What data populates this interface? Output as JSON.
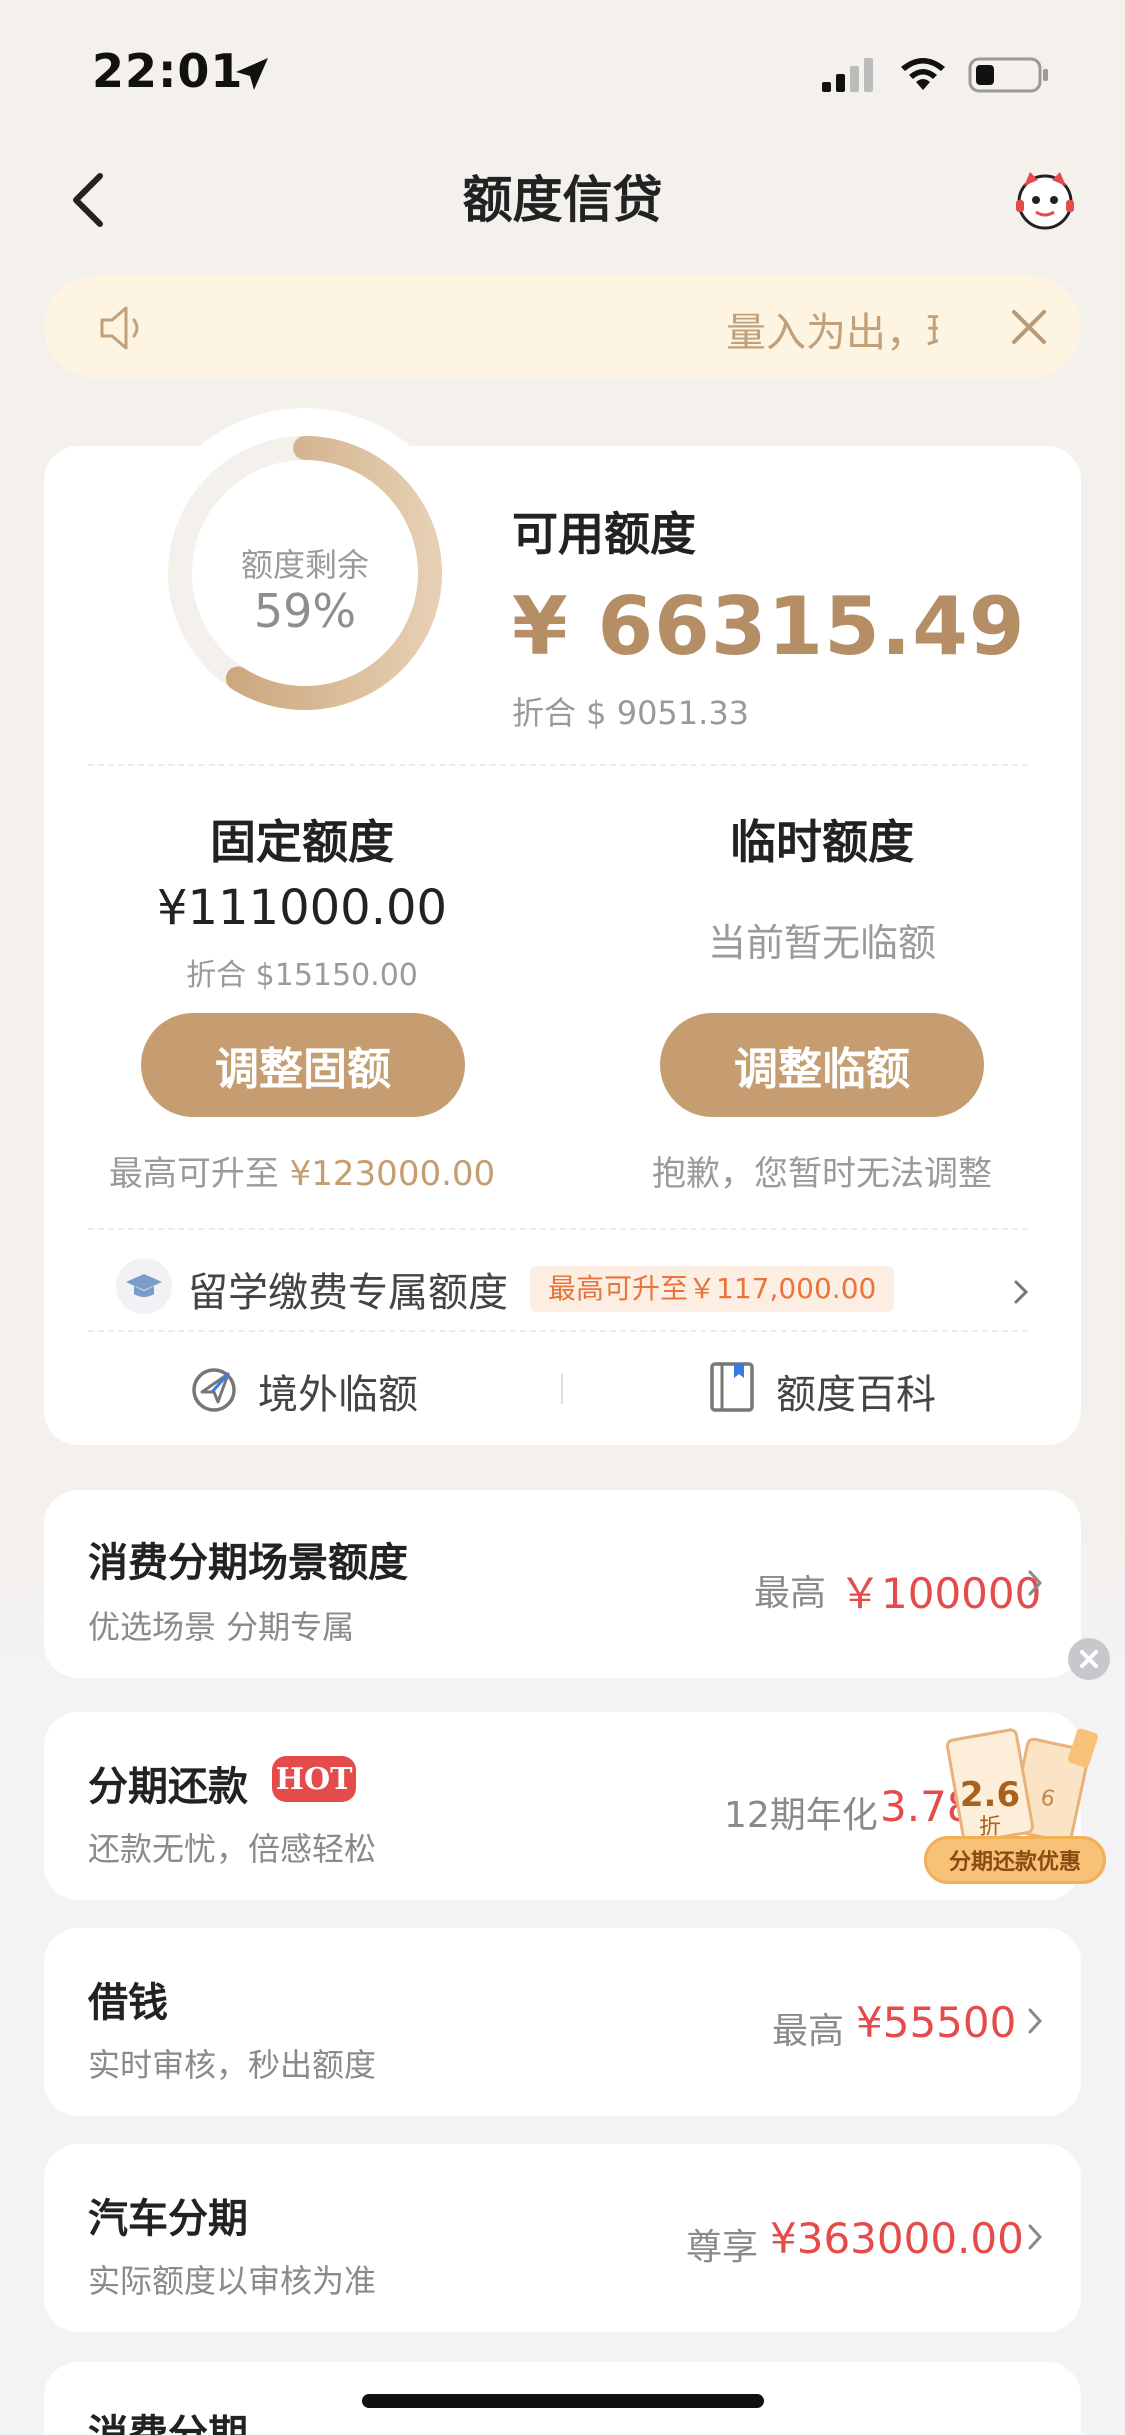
{
  "status_bar": {
    "time": "22:01"
  },
  "nav": {
    "title": "额度信贷"
  },
  "notice": {
    "text": "量入为出，理性消费"
  },
  "credit": {
    "ring_label": "额度剩余",
    "ring_percent": "59%",
    "ring_fraction": 0.59,
    "available_label": "可用额度",
    "available_amount": "¥ 66315.49",
    "available_usd": "折合 $ 9051.33"
  },
  "fixed": {
    "title": "固定额度",
    "amount": "¥111000.00",
    "usd": "折合 $15150.00",
    "button": "调整固额",
    "max_prefix": "最高可升至",
    "max_value": "¥123000.00"
  },
  "temporary": {
    "title": "临时额度",
    "none_text": "当前暂无临额",
    "button": "调整临额",
    "sorry_text": "抱歉，您暂时无法调整"
  },
  "study": {
    "label": "留学缴费专属额度",
    "badge": "最高可升至￥117,000.00"
  },
  "links": {
    "abroad": "境外临额",
    "wiki": "额度百科"
  },
  "products": [
    {
      "title": "消费分期场景额度",
      "subtitle": "优选场景 分期专属",
      "prefix": "最高",
      "value": "￥100000"
    },
    {
      "title": "分期还款",
      "badge": "HOT",
      "subtitle": "还款无忧，倍感轻松",
      "prefix": "12期年化",
      "value": "3.78"
    },
    {
      "title": "借钱",
      "subtitle": "实时审核，秒出额度",
      "prefix": "最高",
      "value": "¥55500"
    },
    {
      "title": "汽车分期",
      "subtitle": "实际额度以审核为准",
      "prefix": "尊享",
      "value": "¥363000.00"
    },
    {
      "title": "消费分期"
    }
  ],
  "promo": {
    "discount": "2.6",
    "discount_unit": "折",
    "label": "分期还款优惠"
  },
  "colors": {
    "accent": "#c59d70",
    "price_red": "#e54b4b",
    "notice_bg": "#fdf4e2"
  }
}
